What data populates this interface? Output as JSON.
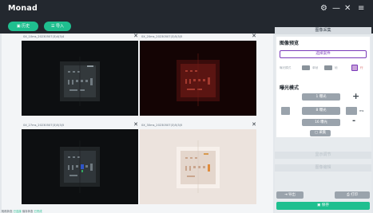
{
  "app": {
    "title": "Monad"
  },
  "window_controls": {
    "settings": "⚙",
    "minimize": "—",
    "close": "✕",
    "menu": "≡"
  },
  "toolbar": {
    "history_label": "历史",
    "import_label": "导入"
  },
  "panels": [
    {
      "label": "0X_10ms_20230507(3)4(3)4",
      "close": "✕"
    },
    {
      "label": "0X_20ms_20230507(3)5(3)5",
      "close": "✕"
    },
    {
      "label": "0X_27ms_20230507(3)5(3)5",
      "close": "✕"
    },
    {
      "label": "0X_30ms_20230507(3)5(3)5",
      "close": "✕"
    }
  ],
  "right": {
    "capture_header": "图像采集",
    "preview_heading": "图像预览",
    "select_button": "选择案件",
    "preview_labels": [
      "曝光模式",
      "单帧",
      "帧",
      "行"
    ],
    "exposure_heading": "曝光模式",
    "mode_buttons": [
      "1 曝光",
      "8 曝光",
      "16 曝光"
    ],
    "unit": "ms",
    "capture_button": "采集",
    "display_header": "显示调节",
    "edit_header": "图像编辑",
    "export_button": "导出",
    "print_button": "打印",
    "save_button": "保存"
  },
  "status": {
    "label1": "相机状态",
    "value1": "已连接",
    "label2": "保存状态",
    "value2": "已完成"
  }
}
